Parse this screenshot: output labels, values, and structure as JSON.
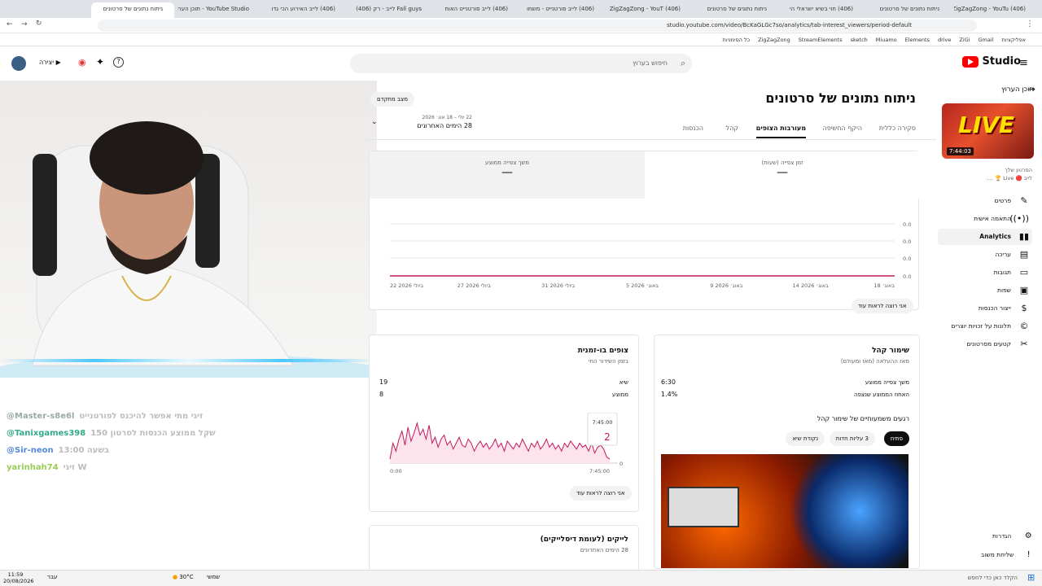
{
  "browser": {
    "tabs": [
      {
        "label": "ניתוח נתונים של סרטונים",
        "active": true
      },
      {
        "label": "YouTube Studio - תוכן הערוץ"
      },
      {
        "label": "(406) לייב האירוע הכי גדו"
      },
      {
        "label": "Fall guys לייב - רק (406)"
      },
      {
        "label": "(406) לייב פורטנייט האוח"
      },
      {
        "label": "(406) לייב פורטנייט - משחו"
      },
      {
        "label": "(406) ZigZagZong - YouT"
      },
      {
        "label": "ניתוח נתונים של סרטונים"
      },
      {
        "label": "(406) חוי בשיא ישראלי הי"
      },
      {
        "label": "ניתוח נתונים של סרטונים"
      },
      {
        "label": "(406) ZigZagZong - YouTu"
      }
    ],
    "url": "studio.youtube.com/video/BcKaGLGc7so/analytics/tab-interest_viewers/period-default",
    "bookmarks": [
      "אפליקציות",
      "Gmail",
      "ZiGi",
      "drive",
      "Elements",
      "Miuamo",
      "sketch",
      "StreamElements",
      "ZigZagZong",
      "כל הסימניות"
    ]
  },
  "header": {
    "logo_text": "Studio",
    "search_placeholder": "חיפוש בערוץ",
    "create_label": "יצירה"
  },
  "sidebar": {
    "back_label": "תוכן הערוץ",
    "video_duration": "7:44:03",
    "thumb_text": "LIVE",
    "your_video_label": "הסרטון שלך",
    "video_title": "לייב 🔴 Live 🏆 ....",
    "items": [
      {
        "label": "פרטים",
        "icon": "pencil-icon",
        "glyph": "✎"
      },
      {
        "label": "התאמה אישית",
        "icon": "broadcast-icon",
        "glyph": "((•))"
      },
      {
        "label": "Analytics",
        "icon": "analytics-icon",
        "glyph": "▮▮",
        "active": true
      },
      {
        "label": "עריכה",
        "icon": "editor-icon",
        "glyph": "▤"
      },
      {
        "label": "תגובות",
        "icon": "comments-icon",
        "glyph": "▭"
      },
      {
        "label": "שפות",
        "icon": "subtitles-icon",
        "glyph": "▣"
      },
      {
        "label": "ייצור הכנסות",
        "icon": "dollar-icon",
        "glyph": "$"
      },
      {
        "label": "תלונות על זכויות יוצרים",
        "icon": "copyright-icon",
        "glyph": "©"
      },
      {
        "label": "קטעים מסרטונים",
        "icon": "scissors-icon",
        "glyph": "✂"
      }
    ],
    "settings_label": "הגדרות",
    "feedback_label": "שליחת משוב"
  },
  "main": {
    "title": "ניתוח נתונים של סרטונים",
    "advanced_mode": "מצב מתקדם",
    "date_range_dates": "22 יולי – 18 אוג׳ 2026",
    "date_range_label": "28 הימים האחרונים",
    "tabs": [
      "סקירה כללית",
      "היקף החשיפה",
      "מעורבות הצופים",
      "קהל",
      "הכנסות"
    ],
    "active_tab": "מעורבות הצופים",
    "metric_cards": [
      {
        "label": "זמן צפייה (שעות)",
        "value": "—",
        "selected": true
      },
      {
        "label": "משך צפייה ממוצע",
        "value": "—"
      }
    ],
    "see_more": "אני רוצה לראות עוד"
  },
  "chart_data": [
    {
      "type": "line",
      "x": [
        "22 ביולי 2026",
        "27 ביולי 2026",
        "31 ביולי 2026",
        "5 באוג׳ 2026",
        "9 באוג׳ 2026",
        "14 באוג׳ 2026",
        "18 באוג׳"
      ],
      "series": [
        {
          "values": [
            0,
            0,
            0,
            0,
            0,
            0,
            0
          ]
        }
      ],
      "yticks": [
        "0.0",
        "0.0",
        "0.0",
        "0.0"
      ],
      "color": "#c2185b"
    },
    {
      "type": "area",
      "title": "צופים בו-זמנית",
      "subtitle": "בזמן השידור החי",
      "stats": [
        {
          "label": "שיא",
          "value": "19"
        },
        {
          "label": "ממוצע",
          "value": "8"
        }
      ],
      "x_ticks": [
        "0:00",
        "7:45:00"
      ],
      "tooltip_time": "7:45:00",
      "tooltip_value": "2",
      "y_last": "0",
      "values": [
        2,
        10,
        6,
        12,
        16,
        9,
        18,
        11,
        15,
        20,
        14,
        17,
        12,
        19,
        10,
        13,
        8,
        12,
        14,
        9,
        11,
        7,
        10,
        13,
        9,
        8,
        12,
        10,
        6,
        9,
        11,
        8,
        10,
        7,
        9,
        12,
        8,
        10,
        6,
        11,
        9,
        7,
        10,
        8,
        12,
        9,
        6,
        10,
        8,
        11,
        7,
        9,
        12,
        8,
        10,
        7,
        9,
        6,
        10,
        8,
        11,
        9,
        7,
        10,
        8,
        9,
        6,
        10,
        5,
        8,
        9,
        7,
        3,
        2
      ],
      "ymax": 22,
      "color": "#c2185b"
    }
  ],
  "concurrent_card": {
    "see_more": "אני רוצה לראות עוד"
  },
  "retention_card": {
    "title": "שימור קהל",
    "subtitle": "מאז ההעלאה (מאז ומעולם)",
    "rows": [
      {
        "label": "משך צפייה ממוצע",
        "value": "6:30"
      },
      {
        "label": "האחוז הממוצע שנצפה",
        "value": "1.4%"
      }
    ],
    "key_moments_title": "רגעים משמעותיים של שימור קהל",
    "chips": [
      "פתיח",
      "3 עליות חדות",
      "נקודת שיא"
    ],
    "chip_active": "פתיח"
  },
  "likes_card": {
    "title": "לייקים (לעומת דיסלייקים)",
    "subtitle": "28 הימים האחרונים"
  },
  "chat": [
    {
      "user": "@Master-s8e6l",
      "text": "זיגי מתי אפשר להיכנס לפורטנייט",
      "color": "#9aa"
    },
    {
      "user": "@Tanixgames398",
      "text": "שקל ממוצע הכנסות לסרטון 150",
      "color": "#3a8"
    },
    {
      "user": "@Sir-neon",
      "text": "13:00 בשעה",
      "color": "#58d"
    },
    {
      "user": "yarinhah74",
      "text": "זיגי W",
      "color": "#9c5"
    }
  ],
  "taskbar": {
    "time": "11:59",
    "date": "20/08/2026",
    "weather": "30°C",
    "weather_desc": "שמשי",
    "search": "הקלד כאן כדי לחפש",
    "lang": "עבר"
  }
}
